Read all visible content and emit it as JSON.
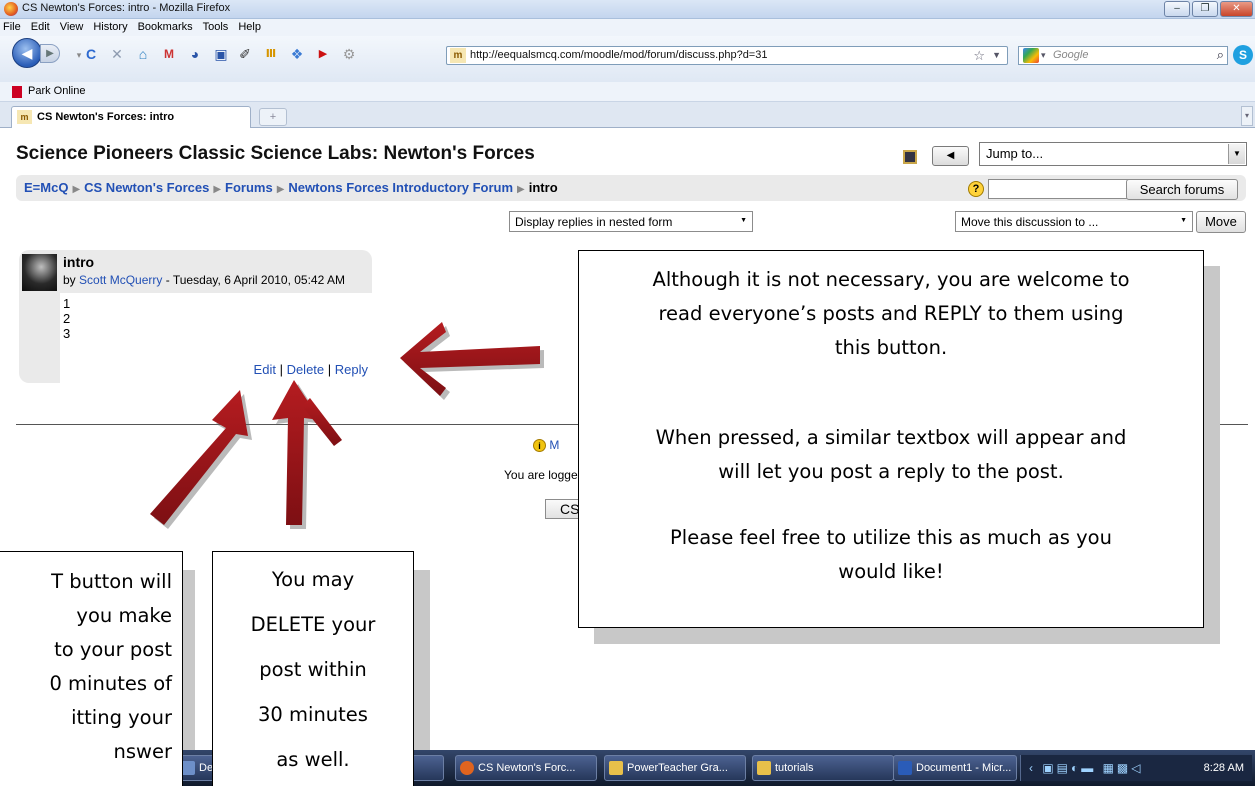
{
  "window": {
    "title": "CS Newton's Forces: intro - Mozilla Firefox",
    "minimize": "–",
    "maximize": "❐",
    "close": "✕"
  },
  "menu": [
    "File",
    "Edit",
    "View",
    "History",
    "Bookmarks",
    "Tools",
    "Help"
  ],
  "toolbar": {
    "url": "http://eequalsmcq.com/moodle/mod/forum/discuss.php?d=31",
    "search_placeholder": "Google"
  },
  "bookmarks": {
    "items": [
      "Park Online"
    ]
  },
  "tabs": {
    "active": "CS Newton's Forces: intro",
    "new_tab": "+"
  },
  "page": {
    "course_title": "Science Pioneers Classic Science Labs: Newton's Forces",
    "jump_to": "Jump to...",
    "breadcrumb": {
      "items": [
        "E=McQ",
        "CS Newton's Forces",
        "Forums",
        "Newtons Forces Introductory Forum"
      ],
      "current": "intro"
    },
    "search_button": "Search forums",
    "display_mode": "Display replies in nested form",
    "move_discussion": "Move this discussion to ...",
    "move_button": "Move",
    "post": {
      "subject": "intro",
      "by": "by",
      "author": "Scott McQuerry",
      "date": "- Tuesday, 6 April 2010, 05:42 AM",
      "lines": [
        "1",
        "2",
        "3"
      ],
      "commands": {
        "edit": "Edit",
        "delete": "Delete",
        "reply": "Reply"
      }
    },
    "footer": {
      "docs_fragment": "M",
      "logged_in_fragment": "You are logge",
      "home_fragment": "CS"
    }
  },
  "callouts": {
    "reply": {
      "lines": [
        "Although it is not necessary, you are welcome to",
        "read everyone’s posts and REPLY to them using",
        "this button.",
        "When pressed, a similar textbox will appear and",
        "will let you post a reply to the post.",
        "Please feel free to utilize this as much as you",
        "would like!"
      ]
    },
    "edit": {
      "lines": [
        "T button will",
        "you make",
        "to your post",
        "0 minutes of",
        "itting your",
        "nswer"
      ]
    },
    "delete": {
      "lines": [
        "You may",
        "DELETE  your",
        "post within",
        "30 minutes",
        "as well."
      ]
    }
  },
  "taskbar": {
    "items": [
      "Del",
      "CS Newton's Forc...",
      "PowerTeacher Gra...",
      "tutorials",
      "Document1 - Micr..."
    ],
    "clock": "8:28 AM"
  },
  "colors": {
    "link": "#2250b5",
    "arrow": "#9b1418",
    "taskbar": "#1e2c48"
  }
}
